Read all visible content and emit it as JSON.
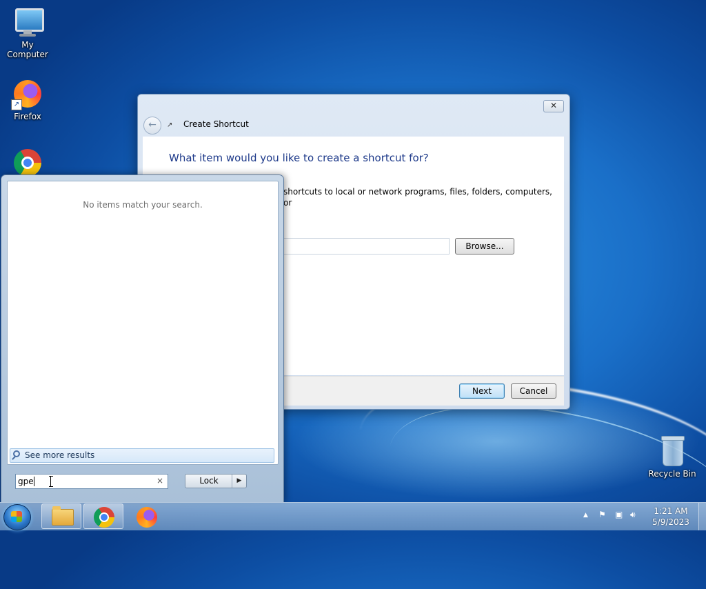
{
  "desktop": {
    "icons": [
      {
        "label": "My Computer",
        "icon": "computer-icon"
      },
      {
        "label": "Firefox",
        "icon": "firefox-icon"
      },
      {
        "label": "",
        "icon": "chrome-icon"
      },
      {
        "label": "Recycle Bin",
        "icon": "recycle-bin-icon"
      }
    ]
  },
  "dialog": {
    "title": "Create Shortcut",
    "close_glyph": "✕",
    "back_glyph": "←",
    "heading": "What item would you like to create a shortcut for?",
    "description": "shortcuts to local or network programs, files, folders, computers, or",
    "location_value": "",
    "browse_label": "Browse...",
    "next_label": "Next",
    "cancel_label": "Cancel"
  },
  "start_menu": {
    "empty_message": "No items match your search.",
    "see_more_label": "See more results",
    "search_value": "gpe",
    "clear_glyph": "×",
    "lock_label": "Lock",
    "lock_arrow": "▶"
  },
  "taskbar": {
    "pinned": [
      "windows-explorer-icon",
      "chrome-icon",
      "firefox-icon"
    ],
    "tray": {
      "up_arrow": "▲"
    },
    "clock": {
      "time": "1:21 AM",
      "date": "5/9/2023"
    }
  },
  "colors": {
    "dialog_heading": "#1e3a8a",
    "desktop_blue": "#1a6fc8",
    "primary_button": "#3c7fb1"
  }
}
